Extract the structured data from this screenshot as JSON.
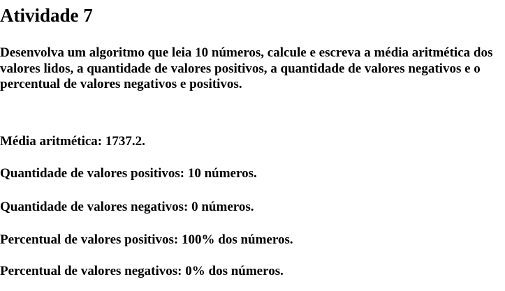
{
  "page": {
    "title": "Atividade 7",
    "description": "Desenvolva um algoritmo que leia 10 números, calcule e escreva a média aritmética dos valores lidos, a quantidade de valores positivos, a quantidade de valores negativos e o percentual de valores negativos e positivos."
  },
  "results": {
    "average": "Média aritmética: 1737.2.",
    "positive_count": "Quantidade de valores positivos: 10 números.",
    "negative_count": "Quantidade de valores negativos: 0 números.",
    "positive_percent": "Percentual de valores positivos: 100% dos números.",
    "negative_percent": "Percentual de valores negativos: 0% dos números."
  }
}
